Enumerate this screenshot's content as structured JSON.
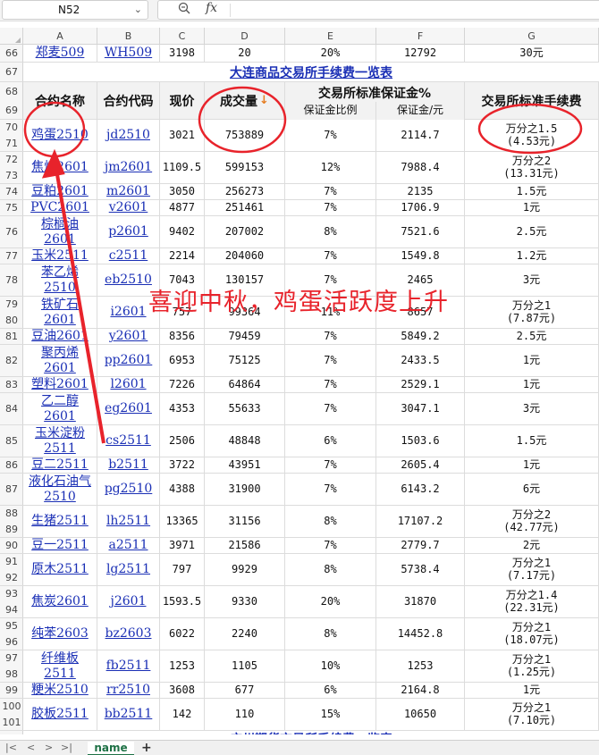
{
  "formula_bar": {
    "cell_ref": "N52",
    "fx_label": "fx"
  },
  "columns": [
    "A",
    "B",
    "C",
    "D",
    "E",
    "F",
    "G"
  ],
  "rows": [
    {
      "type": "data",
      "nums": [
        "66"
      ],
      "cells": [
        "郑麦509",
        "WH509",
        "3198",
        "20",
        "20%",
        "12792",
        "30元"
      ]
    },
    {
      "type": "title",
      "nums": [
        "67"
      ],
      "text": "大连商品交易所手续费一览表"
    },
    {
      "type": "header",
      "nums": [
        "68",
        "69"
      ],
      "h": {
        "name": "合约名称",
        "code": "合约代码",
        "price": "现价",
        "volume": "成交量",
        "margin_group": "交易所标准保证金%",
        "margin_ratio": "保证金比例",
        "margin_amount": "保证金/元",
        "fee": "交易所标准手续费"
      }
    },
    {
      "type": "data",
      "nums": [
        "70",
        "71"
      ],
      "cells": [
        "鸡蛋2510",
        "jd2510",
        "3021",
        "753889",
        "7%",
        "2114.7",
        "万分之1.5\n(4.53元)"
      ]
    },
    {
      "type": "data",
      "nums": [
        "72",
        "73"
      ],
      "cells": [
        "焦煤2601",
        "jm2601",
        "1109.5",
        "599153",
        "12%",
        "7988.4",
        "万分之2\n(13.31元)"
      ]
    },
    {
      "type": "data",
      "nums": [
        "74"
      ],
      "cells": [
        "豆粕2601",
        "m2601",
        "3050",
        "256273",
        "7%",
        "2135",
        "1.5元"
      ]
    },
    {
      "type": "data",
      "nums": [
        "75"
      ],
      "cells": [
        "PVC2601",
        "v2601",
        "4877",
        "251461",
        "7%",
        "1706.9",
        "1元"
      ]
    },
    {
      "type": "data",
      "nums": [
        "76"
      ],
      "cells": [
        "棕榈油\n2601",
        "p2601",
        "9402",
        "207002",
        "8%",
        "7521.6",
        "2.5元"
      ]
    },
    {
      "type": "data",
      "nums": [
        "77"
      ],
      "cells": [
        "玉米2511",
        "c2511",
        "2214",
        "204060",
        "7%",
        "1549.8",
        "1.2元"
      ]
    },
    {
      "type": "data",
      "nums": [
        "78"
      ],
      "cells": [
        "苯乙烯\n2510",
        "eb2510",
        "7043",
        "130157",
        "7%",
        "2465",
        "3元"
      ]
    },
    {
      "type": "data",
      "nums": [
        "79",
        "80"
      ],
      "cells": [
        "铁矿石\n2601",
        "i2601",
        "757",
        "99364",
        "11%",
        "8657",
        "万分之1\n(7.87元)"
      ]
    },
    {
      "type": "data",
      "nums": [
        "81"
      ],
      "cells": [
        "豆油2601",
        "y2601",
        "8356",
        "79459",
        "7%",
        "5849.2",
        "2.5元"
      ]
    },
    {
      "type": "data",
      "nums": [
        "82"
      ],
      "cells": [
        "聚丙烯\n2601",
        "pp2601",
        "6953",
        "75125",
        "7%",
        "2433.5",
        "1元"
      ]
    },
    {
      "type": "data",
      "nums": [
        "83"
      ],
      "cells": [
        "塑料2601",
        "l2601",
        "7226",
        "64864",
        "7%",
        "2529.1",
        "1元"
      ]
    },
    {
      "type": "data",
      "nums": [
        "84"
      ],
      "cells": [
        "乙二醇\n2601",
        "eg2601",
        "4353",
        "55633",
        "7%",
        "3047.1",
        "3元"
      ]
    },
    {
      "type": "data",
      "nums": [
        "85"
      ],
      "cells": [
        "玉米淀粉\n2511",
        "cs2511",
        "2506",
        "48848",
        "6%",
        "1503.6",
        "1.5元"
      ]
    },
    {
      "type": "data",
      "nums": [
        "86"
      ],
      "cells": [
        "豆二2511",
        "b2511",
        "3722",
        "43951",
        "7%",
        "2605.4",
        "1元"
      ]
    },
    {
      "type": "data",
      "nums": [
        "87"
      ],
      "cells": [
        "液化石油气\n2510",
        "pg2510",
        "4388",
        "31900",
        "7%",
        "6143.2",
        "6元"
      ]
    },
    {
      "type": "data",
      "nums": [
        "88",
        "89"
      ],
      "cells": [
        "生猪2511",
        "lh2511",
        "13365",
        "31156",
        "8%",
        "17107.2",
        "万分之2\n(42.77元)"
      ]
    },
    {
      "type": "data",
      "nums": [
        "90"
      ],
      "cells": [
        "豆一2511",
        "a2511",
        "3971",
        "21586",
        "7%",
        "2779.7",
        "2元"
      ]
    },
    {
      "type": "data",
      "nums": [
        "91",
        "92"
      ],
      "cells": [
        "原木2511",
        "lg2511",
        "797",
        "9929",
        "8%",
        "5738.4",
        "万分之1\n(7.17元)"
      ]
    },
    {
      "type": "data",
      "nums": [
        "93",
        "94"
      ],
      "cells": [
        "焦炭2601",
        "j2601",
        "1593.5",
        "9330",
        "20%",
        "31870",
        "万分之1.4\n(22.31元)"
      ]
    },
    {
      "type": "data",
      "nums": [
        "95",
        "96"
      ],
      "cells": [
        "纯苯2603",
        "bz2603",
        "6022",
        "2240",
        "8%",
        "14452.8",
        "万分之1\n(18.07元)"
      ]
    },
    {
      "type": "data",
      "nums": [
        "97",
        "98"
      ],
      "cells": [
        "纤维板\n2511",
        "fb2511",
        "1253",
        "1105",
        "10%",
        "1253",
        "万分之1\n(1.25元)"
      ]
    },
    {
      "type": "data",
      "nums": [
        "99"
      ],
      "cells": [
        "粳米2510",
        "rr2510",
        "3608",
        "677",
        "6%",
        "2164.8",
        "1元"
      ]
    },
    {
      "type": "data",
      "nums": [
        "100",
        "101"
      ],
      "cells": [
        "胶板2511",
        "bb2511",
        "142",
        "110",
        "15%",
        "10650",
        "万分之1\n(7.10元)"
      ]
    },
    {
      "type": "title",
      "nums": [
        "102"
      ],
      "text": "广州期货交易所手续费一览表"
    }
  ],
  "annotation": {
    "caption": "喜迎中秋，鸡蛋活跃度上升",
    "color": "#e8232b"
  },
  "sheet_tabs": {
    "active": "name",
    "add": "+"
  },
  "nav": {
    "first": "|<",
    "prev": "<",
    "next": ">",
    "last": ">|"
  }
}
